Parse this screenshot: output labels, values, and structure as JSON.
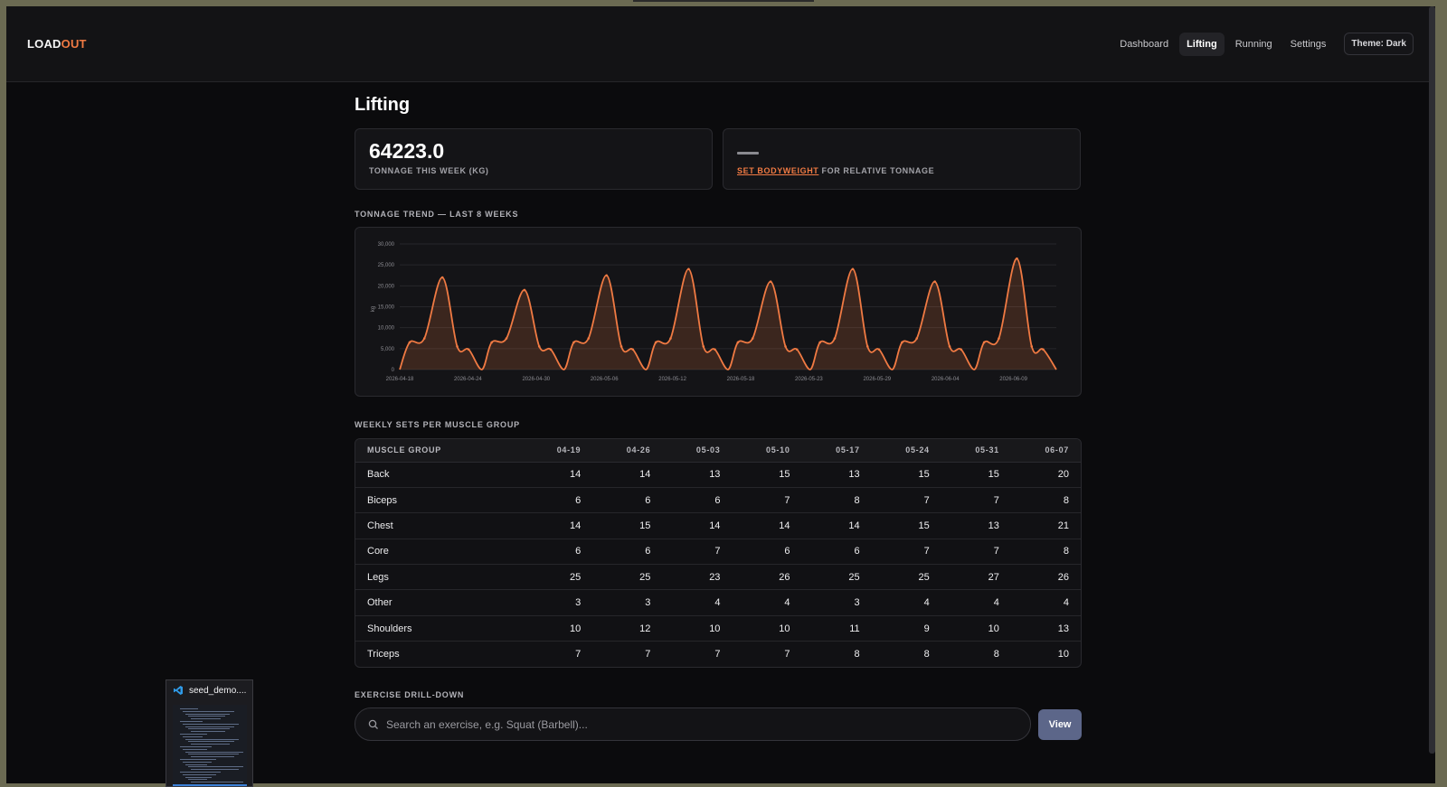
{
  "header": {
    "logo_bold": "LOAD",
    "logo_accent": "OUT",
    "nav": [
      "Dashboard",
      "Lifting",
      "Running",
      "Settings"
    ],
    "active_nav": "Lifting",
    "theme_button": "Theme: Dark"
  },
  "page": {
    "title": "Lifting"
  },
  "stats": {
    "tonnage_value": "64223.0",
    "tonnage_label": "TONNAGE THIS WEEK (KG)",
    "bodyweight_value": "—",
    "bodyweight_link": "SET BODYWEIGHT",
    "bodyweight_suffix": " FOR RELATIVE TONNAGE"
  },
  "trend": {
    "section_label": "TONNAGE TREND — LAST 8 WEEKS"
  },
  "chart_data": {
    "type": "area",
    "ylabel": "kg",
    "ylim": [
      0,
      30000
    ],
    "yticks": [
      "0",
      "5,000",
      "10,000",
      "15,000",
      "20,000",
      "25,000",
      "30,000"
    ],
    "xticks": [
      "2026-04-18",
      "2026-04-24",
      "2026-04-30",
      "2026-05-06",
      "2026-05-12",
      "2026-05-18",
      "2026-05-23",
      "2026-05-29",
      "2026-06-04",
      "2026-06-09"
    ],
    "peaks": [
      22000,
      19000,
      22500,
      24000,
      21000,
      24000,
      21000,
      26500
    ],
    "color": "#f07a43"
  },
  "table": {
    "section_label": "WEEKLY SETS PER MUSCLE GROUP",
    "columns": [
      "MUSCLE GROUP",
      "04-19",
      "04-26",
      "05-03",
      "05-10",
      "05-17",
      "05-24",
      "05-31",
      "06-07"
    ],
    "rows": [
      [
        "Back",
        "14",
        "14",
        "13",
        "15",
        "13",
        "15",
        "15",
        "20"
      ],
      [
        "Biceps",
        "6",
        "6",
        "6",
        "7",
        "8",
        "7",
        "7",
        "8"
      ],
      [
        "Chest",
        "14",
        "15",
        "14",
        "14",
        "14",
        "15",
        "13",
        "21"
      ],
      [
        "Core",
        "6",
        "6",
        "7",
        "6",
        "6",
        "7",
        "7",
        "8"
      ],
      [
        "Legs",
        "25",
        "25",
        "23",
        "26",
        "25",
        "25",
        "27",
        "26"
      ],
      [
        "Other",
        "3",
        "3",
        "4",
        "4",
        "3",
        "4",
        "4",
        "4"
      ],
      [
        "Shoulders",
        "10",
        "12",
        "10",
        "10",
        "11",
        "9",
        "10",
        "13"
      ],
      [
        "Triceps",
        "7",
        "7",
        "7",
        "7",
        "8",
        "8",
        "8",
        "10"
      ]
    ]
  },
  "drilldown": {
    "section_label": "EXERCISE DRILL-DOWN",
    "search_placeholder": "Search an exercise, e.g. Squat (Barbell)...",
    "view_button": "View"
  },
  "taskbar_preview": {
    "title": "seed_demo...."
  }
}
